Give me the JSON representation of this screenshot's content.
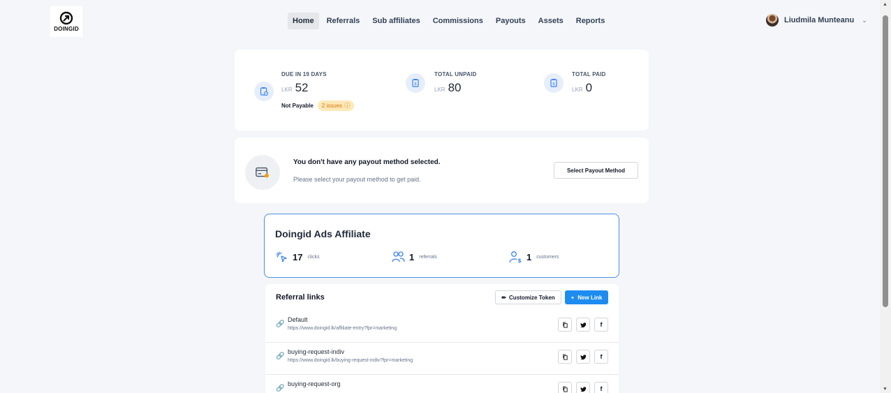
{
  "brand": {
    "logo_text": "DOINGID"
  },
  "nav": {
    "items": [
      {
        "label": "Home",
        "active": true
      },
      {
        "label": "Referrals",
        "active": false
      },
      {
        "label": "Sub affiliates",
        "active": false
      },
      {
        "label": "Commissions",
        "active": false
      },
      {
        "label": "Payouts",
        "active": false
      },
      {
        "label": "Assets",
        "active": false
      },
      {
        "label": "Reports",
        "active": false
      }
    ]
  },
  "user": {
    "name": "Liudmila Munteanu"
  },
  "stats": {
    "due": {
      "label": "DUE IN 19 DAYS",
      "currency": "LKR",
      "amount": "52"
    },
    "unpaid": {
      "label": "TOTAL UNPAID",
      "currency": "LKR",
      "amount": "80"
    },
    "paid": {
      "label": "TOTAL PAID",
      "currency": "LKR",
      "amount": "0"
    },
    "not_payable": "Not Payable",
    "issues": "2 issues"
  },
  "payout": {
    "title": "You don't have any payout method selected.",
    "subtitle": "Please select your payout method to get paid.",
    "button": "Select Payout Method"
  },
  "affiliate": {
    "title": "Doingid Ads Affiliate",
    "clicks": {
      "value": "17",
      "label": "clicks"
    },
    "referrals": {
      "value": "1",
      "label": "referrals"
    },
    "customers": {
      "value": "1",
      "label": "customers"
    }
  },
  "links": {
    "title": "Referral links",
    "customize_label": "Customize Token",
    "new_link_label": "New Link",
    "rows": [
      {
        "name": "Default",
        "url": "https://www.doingid.lk/affiliate-entry?fpr=marketing"
      },
      {
        "name": "buying-request-indiv",
        "url": "https://www.doingid.lk/buying-request-indiv?fpr=marketing"
      },
      {
        "name": "buying-request-org",
        "url": ""
      }
    ]
  },
  "colors": {
    "accent": "#1d8cf0",
    "warning": "#d97706",
    "card_border": "#4a90e2"
  }
}
